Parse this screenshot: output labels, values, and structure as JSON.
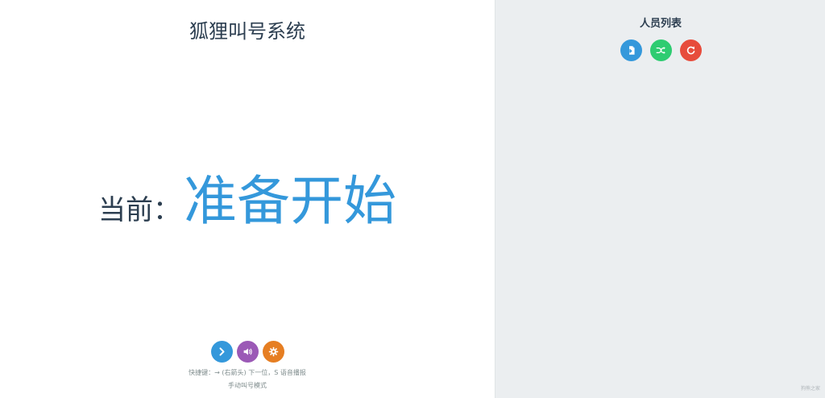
{
  "main": {
    "title": "狐狸叫号系统",
    "current_label": "当前：",
    "current_value": "准备开始",
    "controls": [
      {
        "name": "next",
        "icon": "chevron-right-icon",
        "color": "#3498db"
      },
      {
        "name": "speak",
        "icon": "volume-icon",
        "color": "#9b59b6"
      },
      {
        "name": "settings",
        "icon": "gear-icon",
        "color": "#e67e22"
      }
    ],
    "hint": "快捷键：→ (右箭头) 下一位，S 语音播报",
    "mode": "手动叫号模式"
  },
  "sidebar": {
    "title": "人员列表",
    "controls": [
      {
        "name": "import",
        "icon": "file-import-icon",
        "color": "#3498db"
      },
      {
        "name": "shuffle",
        "icon": "shuffle-icon",
        "color": "#2ecc71"
      },
      {
        "name": "reset",
        "icon": "refresh-icon",
        "color": "#e74c3c"
      }
    ],
    "items": []
  },
  "footer": {
    "mark": "狗熊之家"
  }
}
